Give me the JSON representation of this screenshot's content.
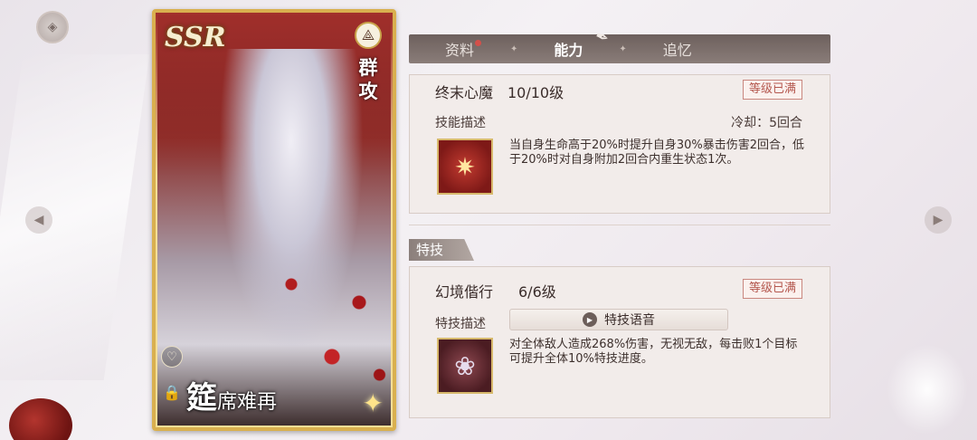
{
  "card": {
    "rarity": "SSR",
    "role": "群攻",
    "name_first": "筵",
    "name_rest": "席难再"
  },
  "tabs": [
    {
      "label": "资料",
      "active": false,
      "has_dot": true
    },
    {
      "label": "能力",
      "active": true,
      "has_dot": false
    },
    {
      "label": "追忆",
      "active": false,
      "has_dot": false
    }
  ],
  "skill": {
    "name": "终末心魔",
    "level": "10/10级",
    "maxed_label": "等级已满",
    "desc_label": "技能描述",
    "cooldown": "冷却：5回合",
    "description": "当自身生命高于20%时提升自身30%暴击伤害2回合，低于20%时对自身附加2回合内重生状态1次。"
  },
  "special": {
    "section_label": "特技",
    "name": "幻境偕行",
    "level": "6/6级",
    "maxed_label": "等级已满",
    "desc_label": "特技描述",
    "voice_label": "特技语音",
    "description": "对全体敌人造成268%伤害，无视无敌，每击败1个目标可提升全体10%特技进度。"
  },
  "icons": {
    "back": "back-button-icon",
    "class": "class-icon",
    "heart": "heart-icon",
    "lock": "lock-icon",
    "quill": "quill-icon",
    "play": "play-icon",
    "arrow_left": "arrow-left-icon",
    "arrow_right": "arrow-right-icon"
  },
  "colors": {
    "card_border": "#d9b04f",
    "tab_bar": "#7a6d69",
    "maxed_tag": "#b4574e",
    "notify_dot": "#d4504a"
  }
}
